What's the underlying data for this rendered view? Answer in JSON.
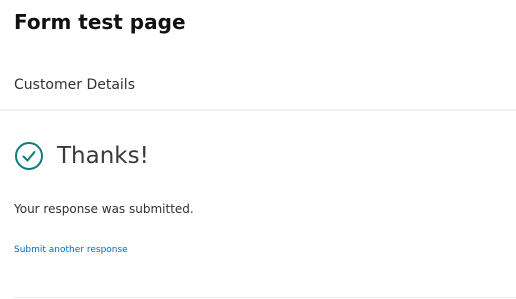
{
  "page": {
    "title": "Form test page"
  },
  "section": {
    "title": "Customer Details"
  },
  "confirmation": {
    "icon": "check-circle-icon",
    "heading": "Thanks!",
    "message": "Your response was submitted.",
    "link_label": "Submit another response"
  },
  "colors": {
    "accent": "#036ac4",
    "success": "#0f7b7b",
    "text": "#323130"
  }
}
